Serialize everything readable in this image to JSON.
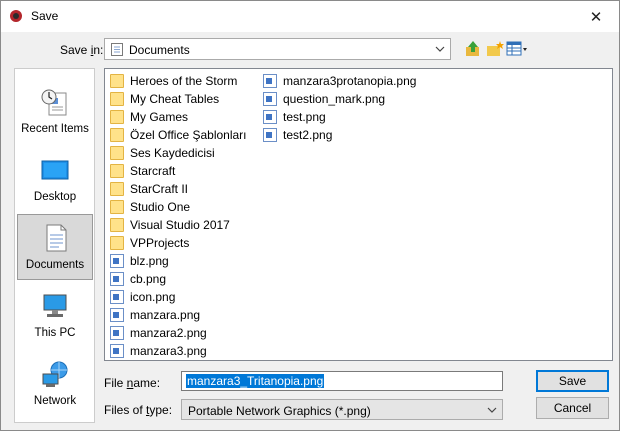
{
  "window": {
    "title": "Save",
    "close_glyph": "✕"
  },
  "toolbar": {
    "save_in_label": "Save in:",
    "location": "Documents",
    "buttons": [
      "up-folder-icon",
      "new-folder-icon",
      "view-menu-icon"
    ]
  },
  "places": [
    {
      "label": "Recent Items",
      "icon": "recent-items-icon",
      "selected": false
    },
    {
      "label": "Desktop",
      "icon": "desktop-icon",
      "selected": false
    },
    {
      "label": "Documents",
      "icon": "documents-icon",
      "selected": true
    },
    {
      "label": "This PC",
      "icon": "this-pc-icon",
      "selected": false
    },
    {
      "label": "Network",
      "icon": "network-icon",
      "selected": false
    }
  ],
  "files": {
    "column1": [
      {
        "name": "Heroes of the Storm",
        "type": "folder"
      },
      {
        "name": "My Cheat Tables",
        "type": "folder"
      },
      {
        "name": "My Games",
        "type": "folder"
      },
      {
        "name": "Özel Office Şablonları",
        "type": "folder"
      },
      {
        "name": "Ses Kaydedicisi",
        "type": "folder"
      },
      {
        "name": "Starcraft",
        "type": "folder"
      },
      {
        "name": "StarCraft II",
        "type": "folder"
      },
      {
        "name": "Studio One",
        "type": "folder"
      },
      {
        "name": "Visual Studio 2017",
        "type": "folder"
      },
      {
        "name": "VPProjects",
        "type": "folder"
      },
      {
        "name": "blz.png",
        "type": "image"
      },
      {
        "name": "cb.png",
        "type": "image"
      },
      {
        "name": "icon.png",
        "type": "image"
      },
      {
        "name": "manzara.png",
        "type": "image"
      },
      {
        "name": "manzara2.png",
        "type": "image"
      },
      {
        "name": "manzara3.png",
        "type": "image"
      }
    ],
    "column2": [
      {
        "name": "manzara3protanopia.png",
        "type": "image"
      },
      {
        "name": "question_mark.png",
        "type": "image"
      },
      {
        "name": "test.png",
        "type": "image"
      },
      {
        "name": "test2.png",
        "type": "image"
      }
    ]
  },
  "form": {
    "file_name_label": "File name:",
    "file_name_value": "manzara3_Tritanopia.png",
    "file_type_label": "Files of type:",
    "file_type_value": "Portable Network Graphics (*.png)"
  },
  "actions": {
    "save_label": "Save",
    "cancel_label": "Cancel"
  },
  "colors": {
    "selection": "#0078d7",
    "folder": "#ffe28a",
    "accent": "#0078d7"
  }
}
